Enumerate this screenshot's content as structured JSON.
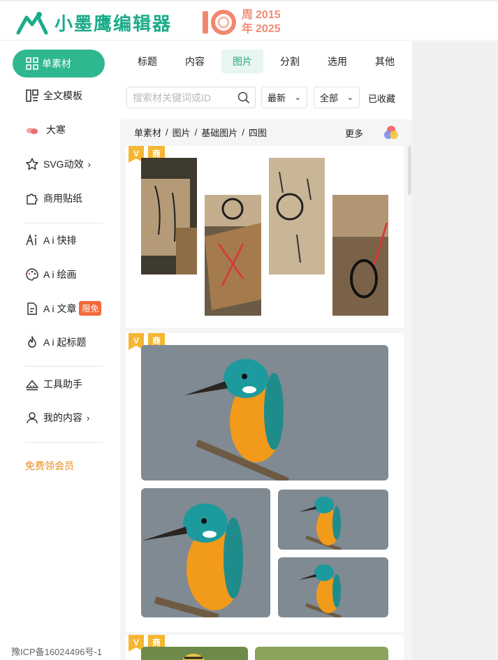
{
  "header": {
    "brand": "小墨鹰编辑器",
    "anniversary": {
      "num": "10",
      "label1": "周",
      "label2": "年",
      "year_start": "2015",
      "year_end": "2025"
    }
  },
  "sidebar": {
    "active": "单素材",
    "items": [
      {
        "label": "全文模板"
      },
      {
        "label": "大寒"
      },
      {
        "label": "SVG动效"
      },
      {
        "label": "商用贴纸"
      },
      {
        "label": "A i 快排"
      },
      {
        "label": "A i 绘画"
      },
      {
        "label": "A i 文章",
        "badge": "限免"
      },
      {
        "label": "A i 起标题"
      },
      {
        "label": "工具助手"
      },
      {
        "label": "我的内容"
      }
    ],
    "vip": "免费领会员",
    "icp": "豫ICP备16024496号-1"
  },
  "tabs": [
    "标题",
    "内容",
    "图片",
    "分割",
    "选用",
    "其他"
  ],
  "active_tab": "图片",
  "search": {
    "placeholder": "搜索材关键词或ID"
  },
  "filters": {
    "sort": "最新",
    "scope": "全部",
    "favorites": "已收藏"
  },
  "breadcrumb": {
    "parts": [
      "单素材",
      "图片",
      "基础图片",
      "四图"
    ],
    "more": "更多"
  },
  "cards": [
    {
      "vip_mark": "V",
      "commercial_tag": "商"
    },
    {
      "vip_mark": "V",
      "commercial_tag": "商"
    },
    {
      "vip_mark": "V",
      "commercial_tag": "商"
    }
  ],
  "colors": {
    "accent": "#2fb88f",
    "brand": "#1aab8a",
    "badge": "#f26a3c",
    "vip_text": "#e88a1f"
  }
}
